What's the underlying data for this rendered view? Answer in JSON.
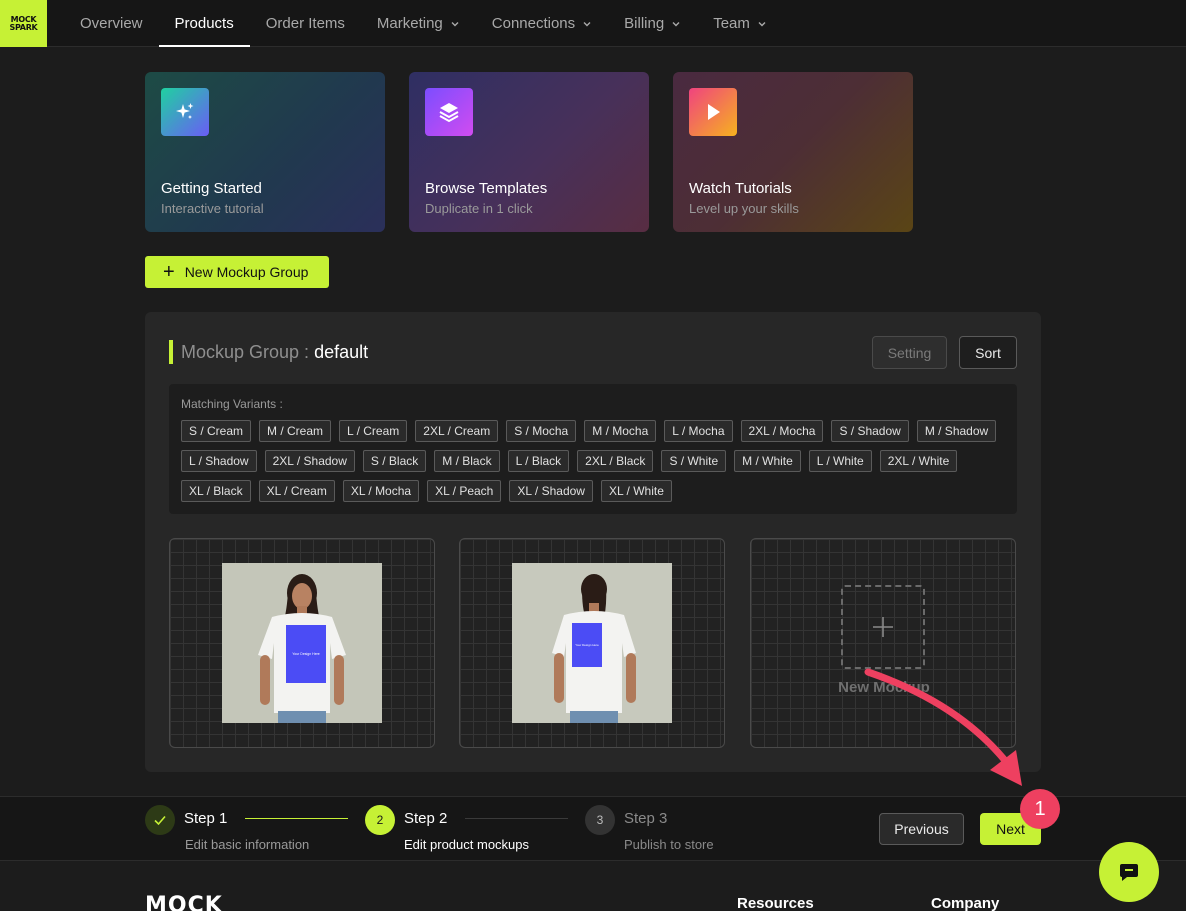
{
  "brand": {
    "logo_text": "MOCK SPARK"
  },
  "nav": {
    "items": [
      {
        "label": "Overview",
        "active": false,
        "dropdown": false
      },
      {
        "label": "Products",
        "active": true,
        "dropdown": false
      },
      {
        "label": "Order Items",
        "active": false,
        "dropdown": false
      },
      {
        "label": "Marketing",
        "active": false,
        "dropdown": true
      },
      {
        "label": "Connections",
        "active": false,
        "dropdown": true
      },
      {
        "label": "Billing",
        "active": false,
        "dropdown": true
      },
      {
        "label": "Team",
        "active": false,
        "dropdown": true
      }
    ]
  },
  "quick_cards": [
    {
      "title": "Getting Started",
      "subtitle": "Interactive tutorial",
      "icon": "sparkles-icon"
    },
    {
      "title": "Browse Templates",
      "subtitle": "Duplicate in 1 click",
      "icon": "layers-icon"
    },
    {
      "title": "Watch Tutorials",
      "subtitle": "Level up your skills",
      "icon": "play-icon"
    }
  ],
  "new_group_button": {
    "label": "New Mockup Group",
    "icon": "plus-icon"
  },
  "mockup_group": {
    "label": "Mockup Group :",
    "name": "default",
    "setting_label": "Setting",
    "sort_label": "Sort",
    "variants_label": "Matching Variants :",
    "variants": [
      "S / Cream",
      "M / Cream",
      "L / Cream",
      "2XL / Cream",
      "S / Mocha",
      "M / Mocha",
      "L / Mocha",
      "2XL / Mocha",
      "S / Shadow",
      "M / Shadow",
      "L / Shadow",
      "2XL / Shadow",
      "S / Black",
      "M / Black",
      "L / Black",
      "2XL / Black",
      "S / White",
      "M / White",
      "L / White",
      "2XL / White",
      "XL / Black",
      "XL / Cream",
      "XL / Mocha",
      "XL / Peach",
      "XL / Shadow",
      "XL / White"
    ],
    "mockups": [
      {
        "view": "front",
        "design_text": "Your Design Here"
      },
      {
        "view": "back",
        "design_text": "Your Design Here"
      }
    ],
    "new_mockup_label": "New Mockup"
  },
  "stepper": {
    "steps": [
      {
        "number": "1",
        "title": "Step 1",
        "subtitle": "Edit basic information",
        "state": "done"
      },
      {
        "number": "2",
        "title": "Step 2",
        "subtitle": "Edit product mockups",
        "state": "current"
      },
      {
        "number": "3",
        "title": "Step 3",
        "subtitle": "Publish to store",
        "state": "upcoming"
      }
    ],
    "previous_label": "Previous",
    "next_label": "Next"
  },
  "footer": {
    "logo_text": "MOCK",
    "columns": [
      "Resources",
      "Company"
    ]
  },
  "annotation": {
    "badge": "1"
  },
  "colors": {
    "accent": "#c6f135",
    "background": "#1c1c1c",
    "panel": "#272727",
    "design_area": "#4b4cf5",
    "annotation": "#ee4060"
  }
}
